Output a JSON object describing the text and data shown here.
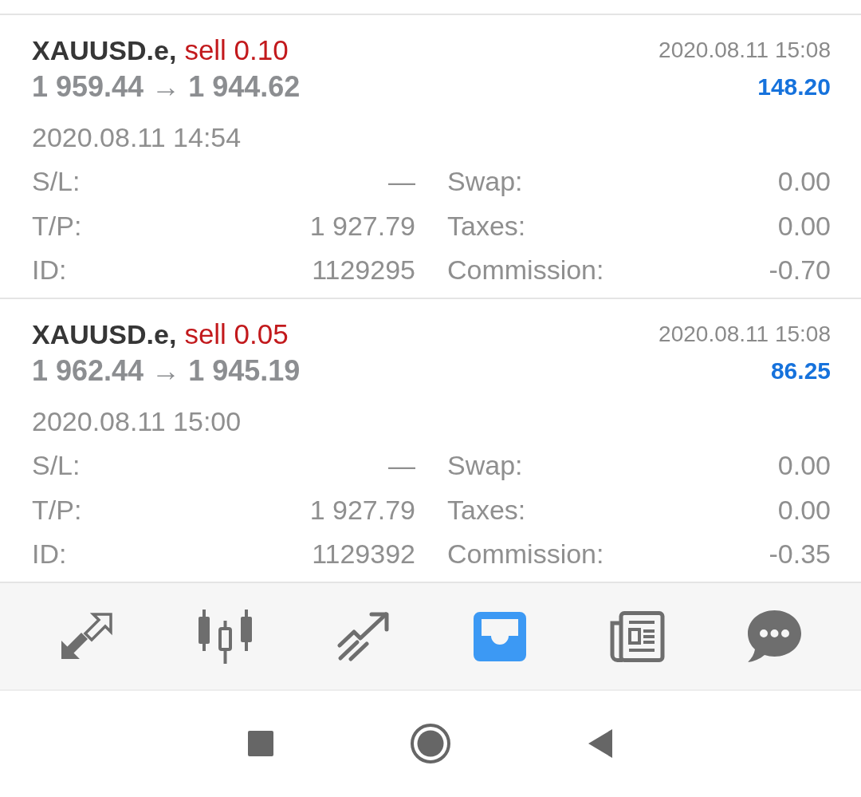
{
  "positions": [
    {
      "symbol": "XAUUSD.e,",
      "order": "sell 0.10",
      "close_time": "2020.08.11 15:08",
      "prices": "1 959.44 → 1 944.62",
      "profit": "148.20",
      "open_time": "2020.08.11 14:54",
      "details": [
        {
          "label": "S/L:",
          "value": "—"
        },
        {
          "label": "Swap:",
          "value": "0.00"
        },
        {
          "label": "T/P:",
          "value": "1 927.79"
        },
        {
          "label": "Taxes:",
          "value": "0.00"
        },
        {
          "label": "ID:",
          "value": "1129295"
        },
        {
          "label": "Commission:",
          "value": "-0.70"
        }
      ]
    },
    {
      "symbol": "XAUUSD.e,",
      "order": "sell 0.05",
      "close_time": "2020.08.11 15:08",
      "prices": "1 962.44 → 1 945.19",
      "profit": "86.25",
      "open_time": "2020.08.11 15:00",
      "details": [
        {
          "label": "S/L:",
          "value": "—"
        },
        {
          "label": "Swap:",
          "value": "0.00"
        },
        {
          "label": "T/P:",
          "value": "1 927.79"
        },
        {
          "label": "Taxes:",
          "value": "0.00"
        },
        {
          "label": "ID:",
          "value": "1129392"
        },
        {
          "label": "Commission:",
          "value": "-0.35"
        }
      ]
    }
  ],
  "nav": {
    "tabs": [
      {
        "kind": "arrows",
        "selected": false
      },
      {
        "kind": "candles",
        "selected": false
      },
      {
        "kind": "trend",
        "selected": false
      },
      {
        "kind": "inbox",
        "selected": true
      },
      {
        "kind": "news",
        "selected": false
      },
      {
        "kind": "chat",
        "selected": false
      }
    ]
  }
}
